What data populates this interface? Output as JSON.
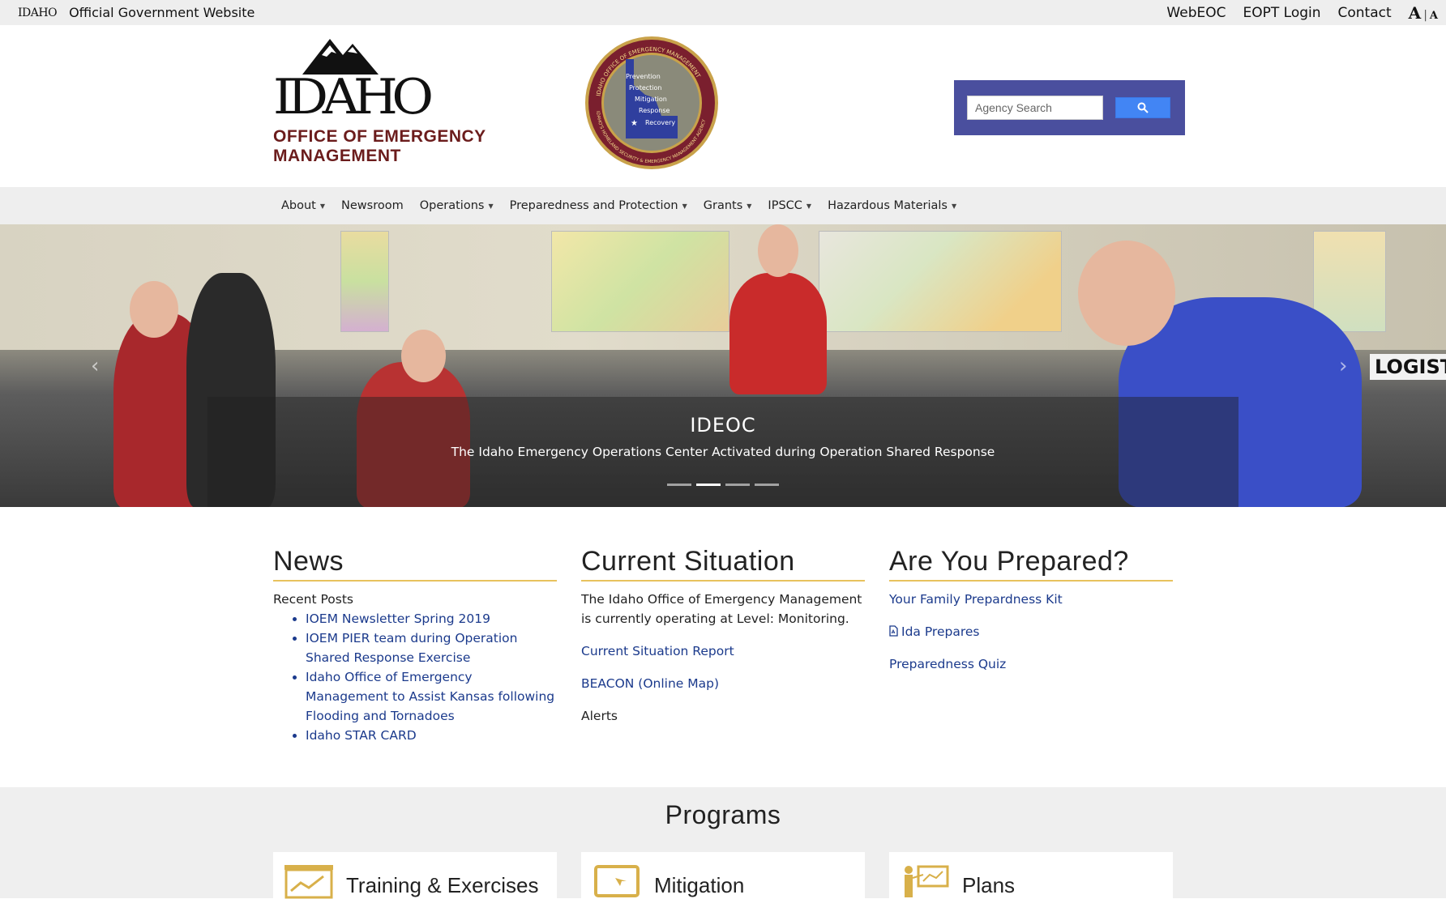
{
  "topbar": {
    "gov_logo": "IDAHO",
    "gov_text": "Official Government Website",
    "links": [
      "WebEOC",
      "EOPT Login",
      "Contact"
    ],
    "font_big": "A",
    "font_sep": "|",
    "font_small": "A"
  },
  "header": {
    "brand_word": "IDAHO",
    "brand_sub_1": "OFFICE OF EMERGENCY",
    "brand_sub_2": "MANAGEMENT",
    "seal_lines": [
      "Prevention",
      "Protection",
      "Mitigation",
      "Response",
      "Recovery"
    ],
    "seal_ring_top": "IDAHO OFFICE OF EMERGENCY MANAGEMENT",
    "seal_ring_bottom": "IDAHO'S HOMELAND SECURITY & EMERGENCY MANAGEMENT AGENCY",
    "search_placeholder": "Agency Search"
  },
  "nav": {
    "items": [
      {
        "label": "About",
        "dropdown": true
      },
      {
        "label": "Newsroom",
        "dropdown": false
      },
      {
        "label": "Operations",
        "dropdown": true
      },
      {
        "label": "Preparedness and Protection",
        "dropdown": true
      },
      {
        "label": "Grants",
        "dropdown": true
      },
      {
        "label": "IPSCC",
        "dropdown": true
      },
      {
        "label": "Hazardous Materials",
        "dropdown": true
      }
    ]
  },
  "hero": {
    "title": "IDEOC",
    "subtitle": "The Idaho Emergency Operations Center Activated during Operation Shared Response",
    "slide_count": 4,
    "active_slide": 2,
    "vest_text": "LOGISTI"
  },
  "news": {
    "heading": "News",
    "recent_label": "Recent Posts",
    "posts": [
      "IOEM Newsletter Spring 2019",
      "IOEM PIER team during Operation Shared Response Exercise",
      "Idaho Office of Emergency Management to Assist Kansas following Flooding and Tornadoes",
      "Idaho STAR CARD"
    ]
  },
  "situation": {
    "heading": "Current Situation",
    "text": "The Idaho Office of Emergency Management is currently operating at Level: Monitoring.",
    "report_link": "Current Situation Report",
    "beacon_link": "BEACON (Online Map)",
    "alerts": "Alerts"
  },
  "prepared": {
    "heading": "Are You Prepared?",
    "kit_link": "Your Family Prepardness Kit",
    "ida_link": "Ida Prepares",
    "quiz_link": "Preparedness Quiz"
  },
  "programs": {
    "title": "Programs",
    "cards": [
      "Training & Exercises",
      "Mitigation",
      "Plans"
    ]
  },
  "colors": {
    "accent_gold": "#e8c25e",
    "link_blue": "#1b3a8c",
    "brand_maroon": "#6b1c1c",
    "search_bg": "#4a4f9e",
    "search_btn": "#4285f4"
  }
}
